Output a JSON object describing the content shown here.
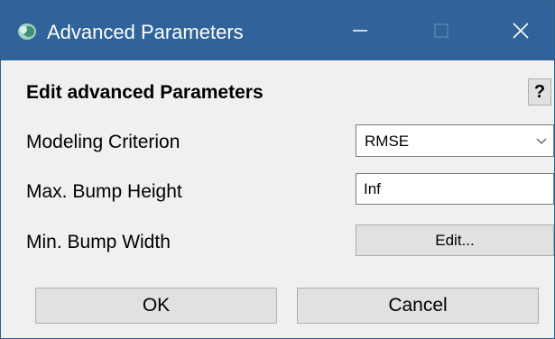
{
  "window": {
    "title": "Advanced Parameters",
    "title_bar_color": "#2f639a",
    "icon": "app-icon",
    "controls": [
      "minimize-icon",
      "maximize-icon",
      "close-icon"
    ]
  },
  "dialog": {
    "heading": "Edit advanced Parameters",
    "help_label": "?",
    "fields": {
      "modeling_criterion": {
        "label": "Modeling Criterion",
        "value": "RMSE"
      },
      "max_bump_height": {
        "label": "Max. Bump Height",
        "value": "Inf"
      },
      "min_bump_width": {
        "label": "Min. Bump Width",
        "button_label": "Edit..."
      }
    },
    "buttons": {
      "ok": "OK",
      "cancel": "Cancel"
    }
  }
}
